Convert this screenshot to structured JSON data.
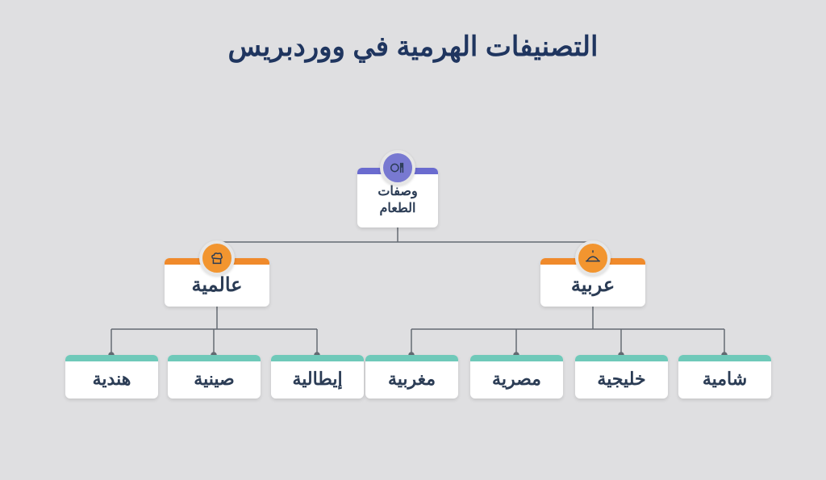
{
  "title": "التصنيفات الهرمية في ووردبريس",
  "root": {
    "label": "وصفات\nالطعام",
    "icon": "utensils-icon"
  },
  "mids": {
    "arabic": {
      "label": "عربية",
      "icon": "dish-icon"
    },
    "global": {
      "label": "عالمية",
      "icon": "chef-icon"
    }
  },
  "leaves": {
    "shami": {
      "label": "شامية"
    },
    "khaliji": {
      "label": "خليجية"
    },
    "misri": {
      "label": "مصرية"
    },
    "maghribi": {
      "label": "مغربية"
    },
    "italian": {
      "label": "إيطالية"
    },
    "chinese": {
      "label": "صينية"
    },
    "indian": {
      "label": "هندية"
    }
  },
  "colors": {
    "title": "#1f355f",
    "root_accent": "#6a6bcf",
    "mid_accent": "#f08a2b",
    "leaf_accent": "#6fc9b9",
    "connector": "#646a72"
  }
}
